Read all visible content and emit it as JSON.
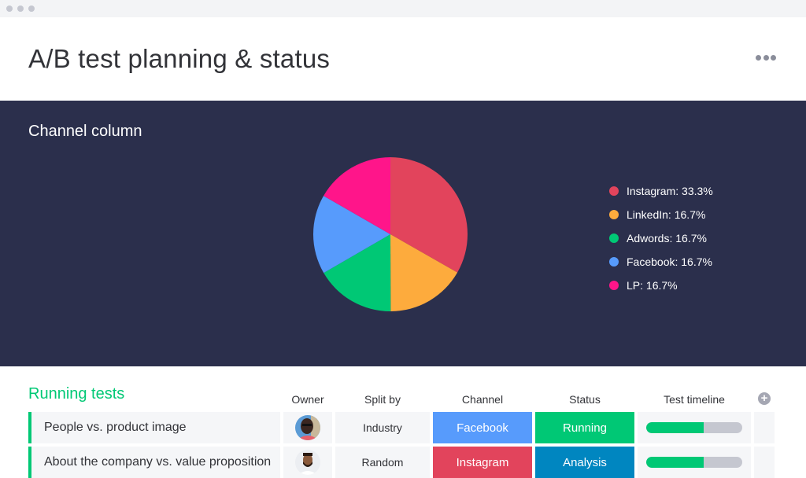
{
  "header": {
    "title": "A/B test planning & status",
    "more_icon": "more-horizontal-icon"
  },
  "chart_panel": {
    "title": "Channel column"
  },
  "chart_data": {
    "type": "pie",
    "title": "Channel column",
    "legend_position": "right",
    "slices": [
      {
        "label": "Instagram",
        "value": 33.3,
        "display": "Instagram: 33.3%",
        "color": "#e2445c"
      },
      {
        "label": "LinkedIn",
        "value": 16.7,
        "display": "LinkedIn: 16.7%",
        "color": "#fdab3d"
      },
      {
        "label": "Adwords",
        "value": 16.7,
        "display": "Adwords: 16.7%",
        "color": "#00c875"
      },
      {
        "label": "Facebook",
        "value": 16.7,
        "display": "Facebook: 16.7%",
        "color": "#579bfc"
      },
      {
        "label": "LP",
        "value": 16.7,
        "display": "LP: 16.7%",
        "color": "#ff158a"
      }
    ]
  },
  "board": {
    "group_title": "Running tests",
    "group_color": "#00c875",
    "columns": [
      "Owner",
      "Split by",
      "Channel",
      "Status",
      "Test timeline"
    ],
    "add_column_icon": "plus-circle-icon",
    "rows": [
      {
        "name": "People vs. product image",
        "owner_avatar": "avatar-man-sunglasses",
        "split_by": "Industry",
        "channel": "Facebook",
        "channel_color": "#579bfc",
        "status": "Running",
        "status_color": "#00c875",
        "timeline_progress": 0.6
      },
      {
        "name": "About the company vs. value proposition",
        "owner_avatar": "avatar-man-beard",
        "split_by": "Random",
        "channel": "Instagram",
        "channel_color": "#e2445c",
        "status": "Analysis",
        "status_color": "#0086c0",
        "timeline_progress": 0.6
      }
    ]
  }
}
